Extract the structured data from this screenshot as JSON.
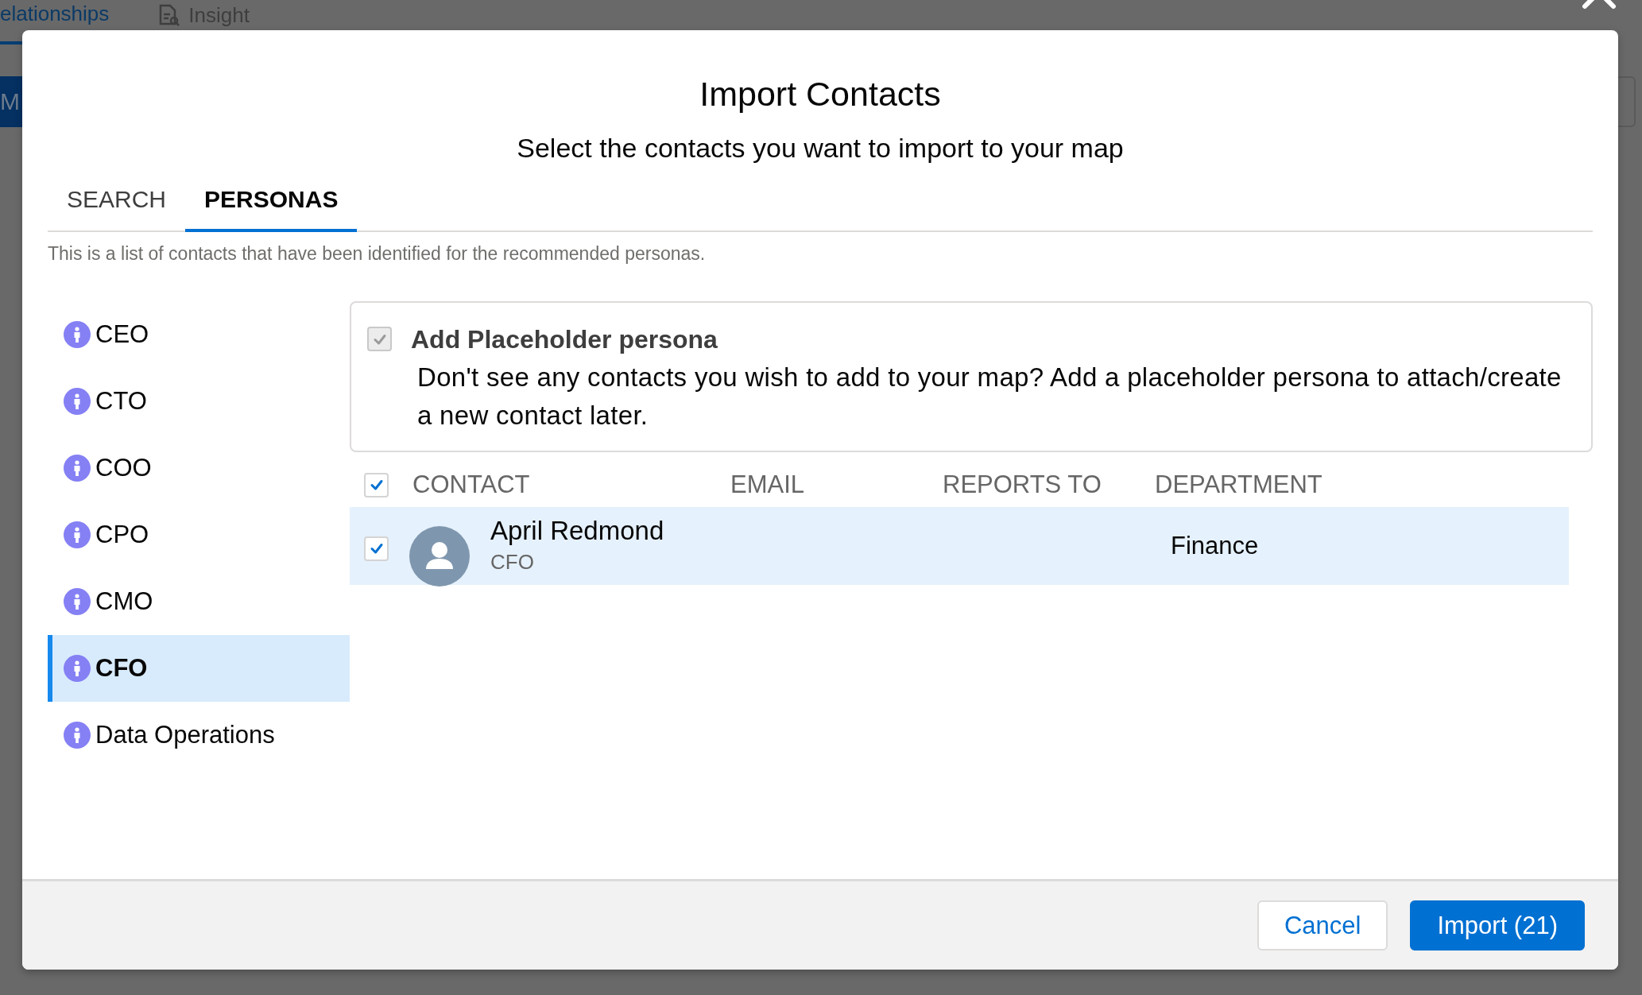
{
  "background": {
    "nav_tabs": [
      {
        "label": "elationships",
        "selected": true,
        "kind": "plain"
      },
      {
        "label": "Insight",
        "selected": false,
        "kind": "document"
      }
    ],
    "side_button": "M"
  },
  "modal": {
    "title": "Import Contacts",
    "subtitle": "Select the contacts you want to import to your map",
    "tabs": [
      {
        "label": "SEARCH",
        "selected": false
      },
      {
        "label": "PERSONAS",
        "selected": true
      }
    ],
    "description": "This is a list of contacts that have been identified for the recommended personas.",
    "personas": [
      {
        "label": "CEO",
        "selected": false
      },
      {
        "label": "CTO",
        "selected": false
      },
      {
        "label": "COO",
        "selected": false
      },
      {
        "label": "CPO",
        "selected": false
      },
      {
        "label": "CMO",
        "selected": false
      },
      {
        "label": "CFO",
        "selected": true
      },
      {
        "label": "Data Operations",
        "selected": false
      }
    ],
    "placeholder": {
      "checked": true,
      "disabled": true,
      "title": "Add Placeholder persona",
      "description": "Don't see any contacts you wish to add to your map? Add a placeholder persona to attach/create a new contact later."
    },
    "table": {
      "select_all": true,
      "columns": [
        "CONTACT",
        "EMAIL",
        "REPORTS TO",
        "DEPARTMENT"
      ],
      "rows": [
        {
          "checked": true,
          "selected": true,
          "name": "April Redmond",
          "title": "CFO",
          "department": "Finance"
        }
      ]
    },
    "buttons": [
      {
        "label": "Cancel",
        "kind": "neutral"
      },
      {
        "label": "Import (21)",
        "kind": "brand"
      }
    ]
  }
}
